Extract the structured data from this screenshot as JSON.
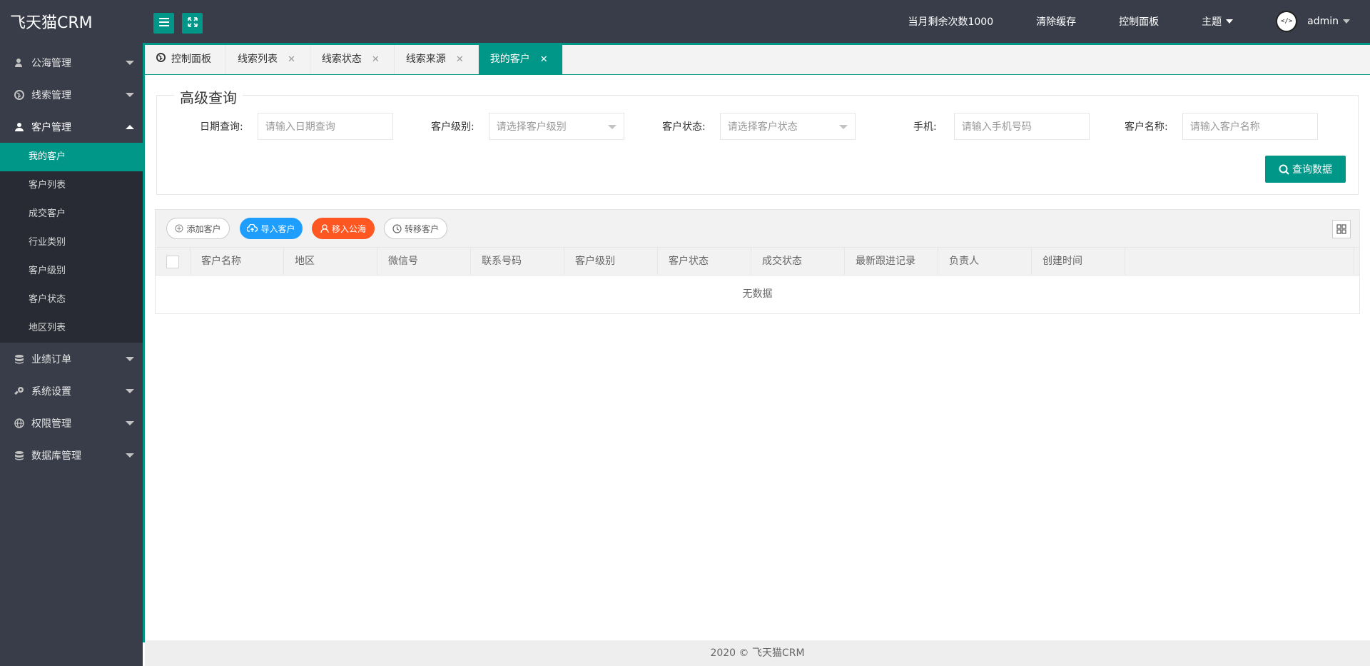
{
  "app": {
    "logo": "飞天猫CRM"
  },
  "sidebar": {
    "groups": [
      {
        "label": "公海管理",
        "icon": "user-icon"
      },
      {
        "label": "线索管理",
        "icon": "globe-icon"
      },
      {
        "label": "客户管理",
        "icon": "person-icon",
        "expanded": true,
        "items": [
          "我的客户",
          "客户列表",
          "成交客户",
          "行业类别",
          "客户级别",
          "客户状态",
          "地区列表"
        ]
      },
      {
        "label": "业绩订单",
        "icon": "database-icon"
      },
      {
        "label": "系统设置",
        "icon": "settings-icon"
      },
      {
        "label": "权限管理",
        "icon": "globe-icon"
      },
      {
        "label": "数据库管理",
        "icon": "database-icon"
      }
    ],
    "active_item": "我的客户"
  },
  "header": {
    "remaining": "当月剩余次数1000",
    "clear_cache": "清除缓存",
    "dashboard": "控制面板",
    "theme": "主题",
    "user": "admin"
  },
  "tabs": [
    {
      "label": "控制面板",
      "closable": false
    },
    {
      "label": "线索列表",
      "closable": true
    },
    {
      "label": "线索状态",
      "closable": true
    },
    {
      "label": "线索来源",
      "closable": true
    },
    {
      "label": "我的客户",
      "closable": true,
      "active": true
    }
  ],
  "query": {
    "legend": "高级查询",
    "date_label": "日期查询:",
    "date_placeholder": "请输入日期查询",
    "level_label": "客户级别:",
    "level_placeholder": "请选择客户级别",
    "status_label": "客户状态:",
    "status_placeholder": "请选择客户状态",
    "phone_label": "手机:",
    "phone_placeholder": "请输入手机号码",
    "name_label": "客户名称:",
    "name_placeholder": "请输入客户名称",
    "search_button": "查询数据"
  },
  "toolbar": {
    "add": "添加客户",
    "import": "导入客户",
    "move": "移入公海",
    "transfer": "转移客户"
  },
  "table": {
    "columns": [
      "客户名称",
      "地区",
      "微信号",
      "联系号码",
      "客户级别",
      "客户状态",
      "成交状态",
      "最新跟进记录",
      "负责人",
      "创建时间"
    ],
    "empty_text": "无数据"
  },
  "footer": {
    "text": "2020 ©   飞天猫CRM"
  },
  "colors": {
    "accent": "#009688",
    "dark": "#393d49",
    "blue": "#1e9fff",
    "orange": "#ff5722"
  }
}
